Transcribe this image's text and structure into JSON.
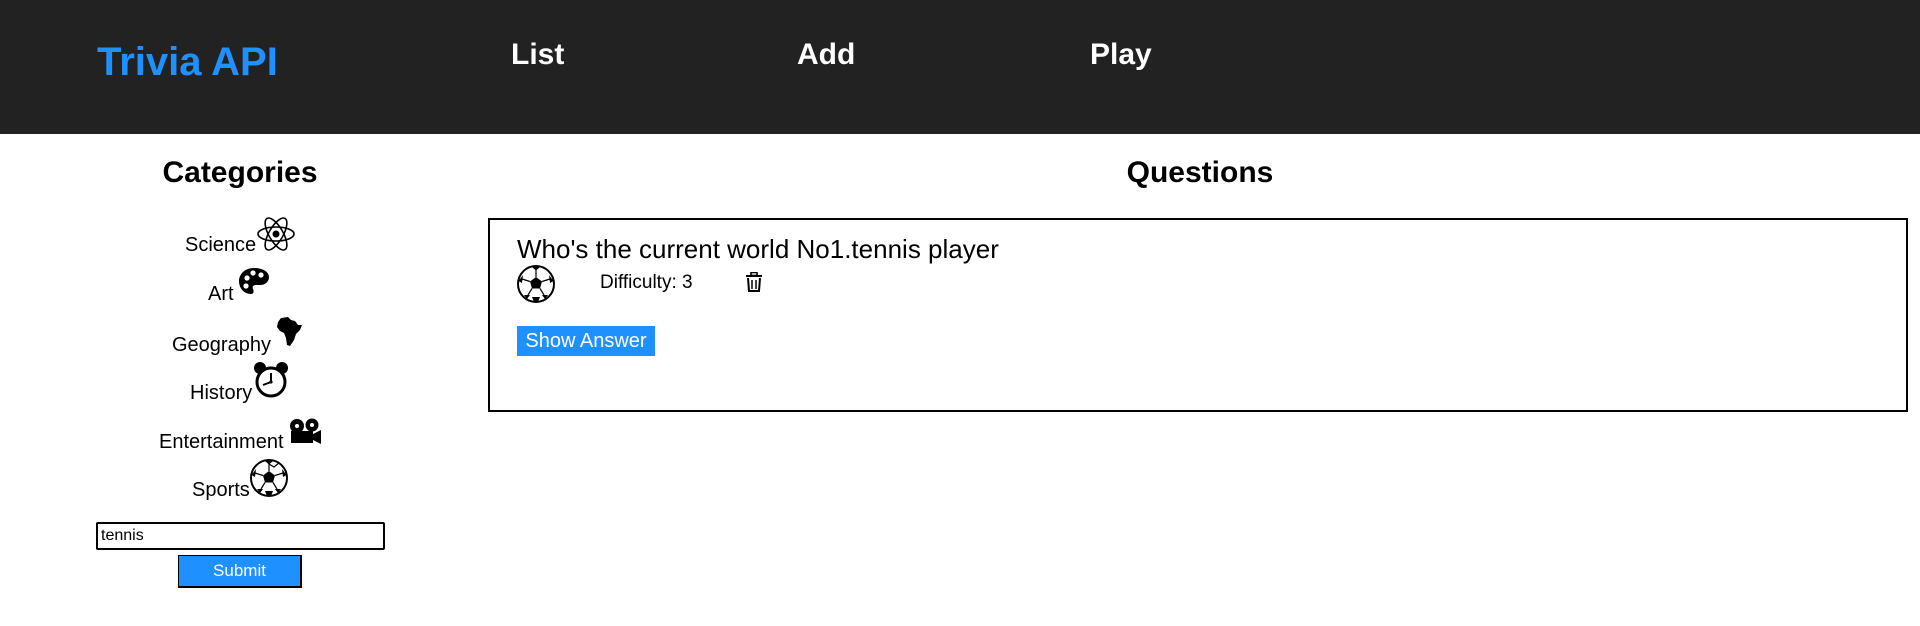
{
  "header": {
    "brand": "Trivia API",
    "nav": {
      "list": "List",
      "add": "Add",
      "play": "Play"
    }
  },
  "sidebar": {
    "title": "Categories",
    "categories": [
      {
        "label": "Science",
        "icon": "atom-icon"
      },
      {
        "label": "Art",
        "icon": "palette-icon"
      },
      {
        "label": "Geography",
        "icon": "africa-icon"
      },
      {
        "label": "History",
        "icon": "alarm-clock-icon"
      },
      {
        "label": "Entertainment",
        "icon": "film-camera-icon"
      },
      {
        "label": "Sports",
        "icon": "soccer-ball-icon"
      }
    ],
    "search": {
      "value": "tennis",
      "submit_label": "Submit"
    }
  },
  "main": {
    "title": "Questions",
    "questions": [
      {
        "text": "Who's the current world No1.tennis player",
        "category_icon": "soccer-ball-icon",
        "difficulty_label": "Difficulty: 3",
        "show_answer_label": "Show Answer"
      }
    ]
  },
  "colors": {
    "header_bg": "#222222",
    "accent": "#1e90ff",
    "nav_text": "#ffffff"
  }
}
